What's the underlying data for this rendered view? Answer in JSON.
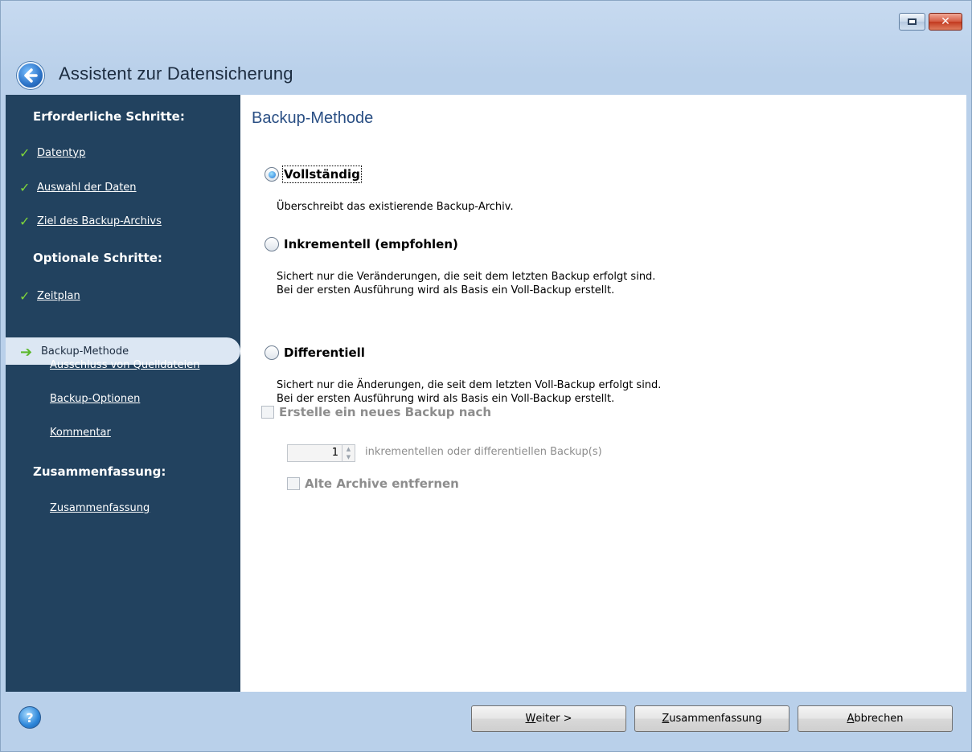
{
  "window": {
    "title": "Assistent zur Datensicherung"
  },
  "sidebar": {
    "required_heading": "Erforderliche Schritte:",
    "optional_heading": "Optionale Schritte:",
    "summary_heading": "Zusammenfassung:",
    "items": [
      {
        "label": "Datentyp",
        "status": "done"
      },
      {
        "label": "Auswahl der Daten",
        "status": "done"
      },
      {
        "label": "Ziel des Backup-Archivs",
        "status": "done"
      },
      {
        "label": "Zeitplan",
        "status": "done"
      },
      {
        "label": "Backup-Methode",
        "status": "current"
      },
      {
        "label": "Ausschluss von Quelldateien",
        "status": "pending"
      },
      {
        "label": "Backup-Optionen",
        "status": "pending"
      },
      {
        "label": "Kommentar",
        "status": "pending"
      },
      {
        "label": "Zusammenfassung",
        "status": "pending"
      }
    ]
  },
  "main": {
    "title": "Backup-Methode",
    "options": [
      {
        "label": "Vollständig",
        "checked": true,
        "desc": [
          "Überschreibt das existierende Backup-Archiv."
        ]
      },
      {
        "label": "Inkrementell (empfohlen)",
        "checked": false,
        "desc": [
          "Sichert nur die Veränderungen, die seit dem letzten Backup erfolgt sind.",
          "Bei der ersten Ausführung wird als Basis ein Voll-Backup erstellt."
        ]
      },
      {
        "label": "Differentiell",
        "checked": false,
        "desc": [
          "Sichert nur die Änderungen, die seit dem letzten Voll-Backup erfolgt sind.",
          "Bei der ersten Ausführung wird als Basis ein Voll-Backup erstellt."
        ]
      }
    ],
    "new_backup_checkbox": {
      "label": "Erstelle ein neues Backup nach",
      "checked": false,
      "disabled": true
    },
    "spinner": {
      "value": "1",
      "suffix": "inkrementellen oder differentiellen Backup(s)"
    },
    "remove_archives_checkbox": {
      "label": "Alte Archive entfernen",
      "checked": false,
      "disabled": true
    }
  },
  "footer": {
    "next_button": {
      "mnemonic": "W",
      "rest": "eiter >"
    },
    "summary_button": {
      "mnemonic": "Z",
      "rest": "usammenfassung"
    },
    "cancel_button": {
      "mnemonic": "A",
      "rest": "bbrechen"
    }
  },
  "colors": {
    "sidebar_bg": "#22425f",
    "title_bar": "#b9d0ea",
    "check": "#7fd63a",
    "section_title": "#2a4f84"
  }
}
